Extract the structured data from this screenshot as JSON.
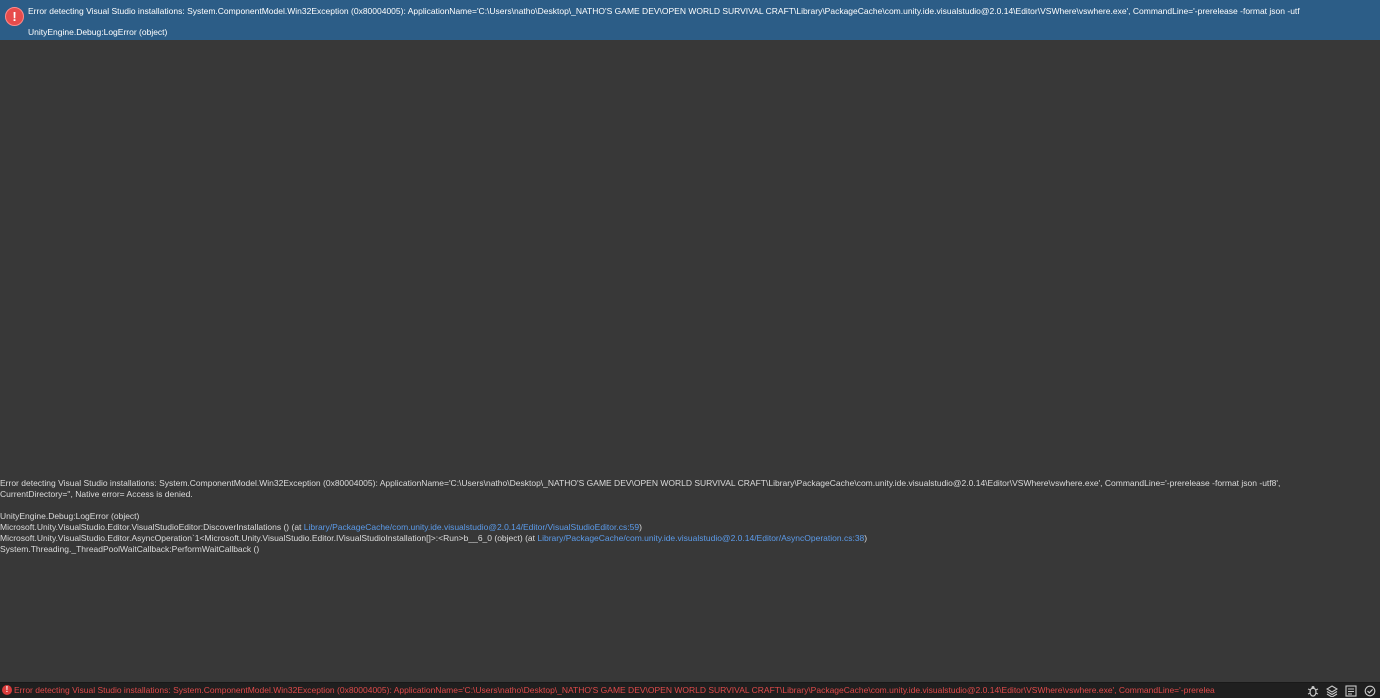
{
  "log_entry": {
    "icon": "error-icon",
    "line1": "Error detecting Visual Studio installations: System.ComponentModel.Win32Exception (0x80004005): ApplicationName='C:\\Users\\natho\\Desktop\\_NATHO'S GAME DEV\\OPEN WORLD SURVIVAL CRAFT\\Library\\PackageCache\\com.unity.ide.visualstudio@2.0.14\\Editor\\VSWhere\\vswhere.exe', CommandLine='-prerelease -format json -utf",
    "line2": "UnityEngine.Debug:LogError (object)"
  },
  "detail": {
    "message_line1": "Error detecting Visual Studio installations: System.ComponentModel.Win32Exception (0x80004005): ApplicationName='C:\\Users\\natho\\Desktop\\_NATHO'S GAME DEV\\OPEN WORLD SURVIVAL CRAFT\\Library\\PackageCache\\com.unity.ide.visualstudio@2.0.14\\Editor\\VSWhere\\vswhere.exe', CommandLine='-prerelease -format json -utf8',",
    "message_line2": "CurrentDirectory='', Native error= Access is denied.",
    "stack": [
      {
        "text": "UnityEngine.Debug:LogError (object)",
        "link": "",
        "suffix": ""
      },
      {
        "text": "Microsoft.Unity.VisualStudio.Editor.VisualStudioEditor:DiscoverInstallations () (at ",
        "link": "Library/PackageCache/com.unity.ide.visualstudio@2.0.14/Editor/VisualStudioEditor.cs:59",
        "suffix": ")"
      },
      {
        "text": "Microsoft.Unity.VisualStudio.Editor.AsyncOperation`1<Microsoft.Unity.VisualStudio.Editor.IVisualStudioInstallation[]>:<Run>b__6_0 (object) (at ",
        "link": "Library/PackageCache/com.unity.ide.visualstudio@2.0.14/Editor/AsyncOperation.cs:38",
        "suffix": ")"
      },
      {
        "text": "System.Threading._ThreadPoolWaitCallback:PerformWaitCallback ()",
        "link": "",
        "suffix": ""
      }
    ]
  },
  "status_bar": {
    "icon": "error-icon",
    "text": "Error detecting Visual Studio installations: System.ComponentModel.Win32Exception (0x80004005): ApplicationName='C:\\Users\\natho\\Desktop\\_NATHO'S GAME DEV\\OPEN WORLD SURVIVAL CRAFT\\Library\\PackageCache\\com.unity.ide.visualstudio@2.0.14\\Editor\\VSWhere\\vswhere.exe', CommandLine='-prerelea",
    "tools": [
      "debug-icon",
      "layers-icon",
      "collab-icon",
      "cloud-check-icon"
    ]
  },
  "colors": {
    "background": "#383838",
    "selected_row": "#2c5d87",
    "error_red": "#e04a4a",
    "link_blue": "#5b9bea"
  }
}
